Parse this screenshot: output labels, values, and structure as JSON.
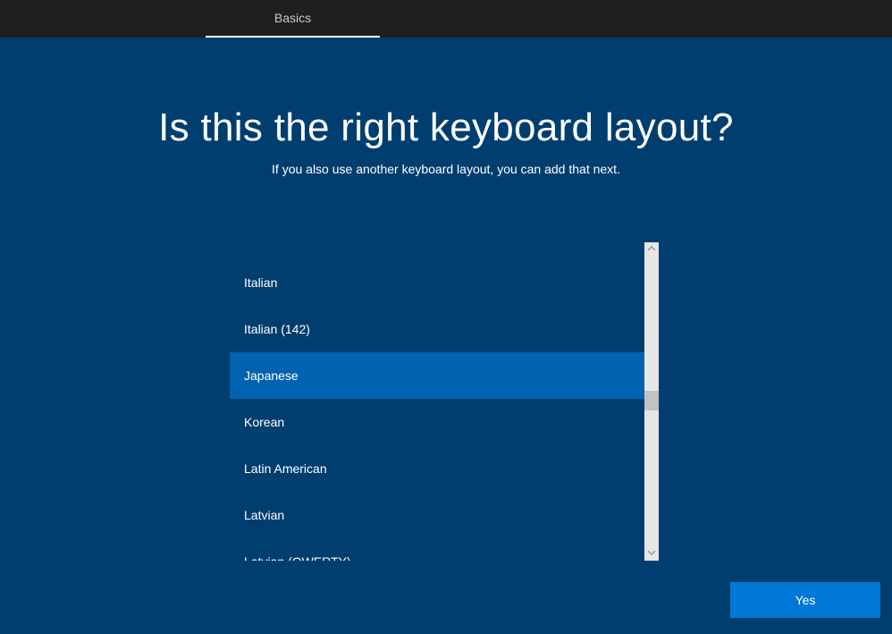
{
  "header": {
    "tab_label": "Basics"
  },
  "main": {
    "title": "Is this the right keyboard layout?",
    "subtitle": "If you also use another keyboard layout, you can add that next."
  },
  "layout_list": {
    "items": [
      "Italian",
      "Italian (142)",
      "Japanese",
      "Korean",
      "Latin American",
      "Latvian",
      "Latvian (QWERTY)"
    ],
    "selected": "Japanese"
  },
  "footer": {
    "yes_label": "Yes"
  },
  "colors": {
    "background": "#003e70",
    "selected_item": "#0063b1",
    "button": "#0078d7",
    "topbar": "#1f1f1f"
  },
  "icons": {
    "scroll_up": "chevron-up-icon",
    "scroll_down": "chevron-down-icon"
  }
}
